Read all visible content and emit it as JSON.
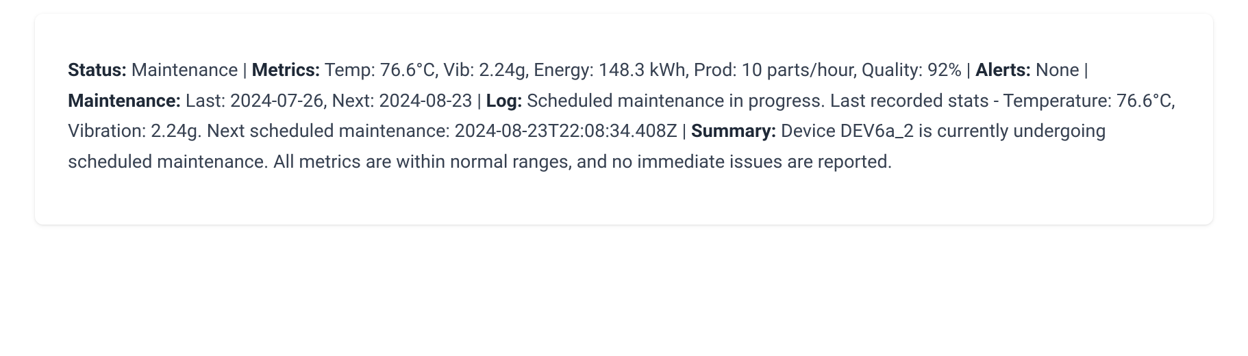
{
  "labels": {
    "status": "Status:",
    "metrics": "Metrics:",
    "alerts": "Alerts:",
    "maintenance": "Maintenance:",
    "log": "Log:",
    "summary": "Summary:"
  },
  "values": {
    "status": " Maintenance | ",
    "metrics": " Temp: 76.6°C, Vib: 2.24g, Energy: 148.3 kWh, Prod: 10 parts/hour, Quality: 92% | ",
    "alerts": " None | ",
    "maintenance": " Last: 2024-07-26, Next: 2024-08-23 | ",
    "log": " Scheduled maintenance in progress. Last recorded stats - Temperature: 76.6°C, Vibration: 2.24g. Next scheduled maintenance: 2024-08-23T22:08:34.408Z | ",
    "summary": " Device DEV6a_2 is currently undergoing scheduled maintenance. All metrics are within normal ranges, and no immediate issues are reported."
  }
}
